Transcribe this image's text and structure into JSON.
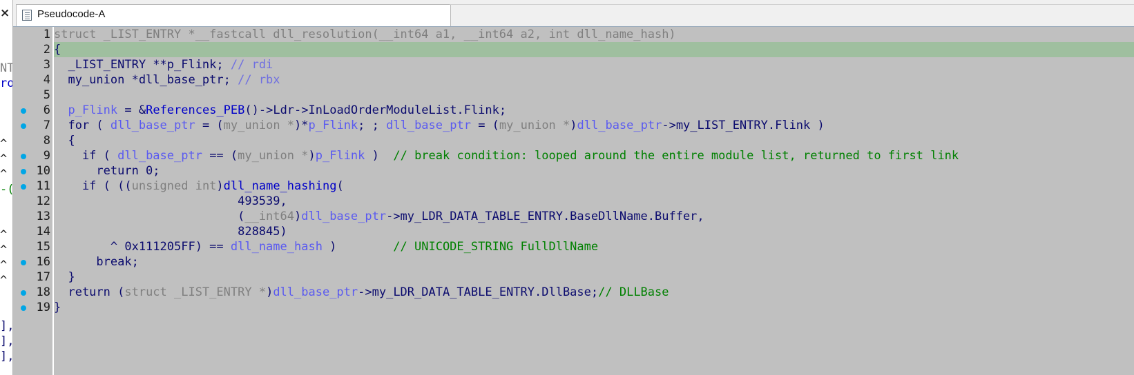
{
  "window": {
    "tab_title": "Pseudocode-A",
    "close_glyph": "×"
  },
  "left_pane": {
    "fragments": [
      {
        "row": 4,
        "text": "NT",
        "color": "#7f7f7f"
      },
      {
        "row": 5,
        "text": "ro",
        "color": "#0000c8"
      },
      {
        "row": 9,
        "text": "^",
        "color": "#222222"
      },
      {
        "row": 10,
        "text": "^",
        "color": "#222222"
      },
      {
        "row": 11,
        "text": "^",
        "color": "#222222"
      },
      {
        "row": 12,
        "text": "-(",
        "color": "#008000"
      },
      {
        "row": 15,
        "text": "^",
        "color": "#222222"
      },
      {
        "row": 16,
        "text": "^",
        "color": "#222222"
      },
      {
        "row": 17,
        "text": "^",
        "color": "#222222"
      },
      {
        "row": 18,
        "text": "^",
        "color": "#222222"
      },
      {
        "row": 21,
        "text": "],",
        "color": "#0b0b6e"
      },
      {
        "row": 22,
        "text": "],",
        "color": "#0b0b6e"
      },
      {
        "row": 23,
        "text": "],",
        "color": "#0b0b6e"
      }
    ]
  },
  "code": {
    "highlighted_line": 2,
    "lines": [
      {
        "n": "1",
        "dot": false,
        "tokens": [
          {
            "t": "struct _LIST_ENTRY *__fastcall dll_resolution(__int64 a1, __int64 a2, int dll_name_hash)",
            "c": "gray"
          }
        ]
      },
      {
        "n": "2",
        "dot": false,
        "tokens": [
          {
            "t": "{",
            "c": "dark"
          }
        ]
      },
      {
        "n": "3",
        "dot": false,
        "tokens": [
          {
            "t": "  _LIST_ENTRY **p_Flink; ",
            "c": "dark"
          },
          {
            "t": "// rdi",
            "c": "cmt2"
          }
        ]
      },
      {
        "n": "4",
        "dot": false,
        "tokens": [
          {
            "t": "  my_union *dll_base_ptr; ",
            "c": "dark"
          },
          {
            "t": "// rbx",
            "c": "cmt2"
          }
        ]
      },
      {
        "n": "5",
        "dot": false,
        "tokens": []
      },
      {
        "n": "6",
        "dot": true,
        "tokens": [
          {
            "t": "  ",
            "c": "dark"
          },
          {
            "t": "p_Flink",
            "c": "var"
          },
          {
            "t": " = &",
            "c": "dark"
          },
          {
            "t": "References_PEB",
            "c": "fn"
          },
          {
            "t": "()->Ldr->InLoadOrderModuleList.Flink;",
            "c": "dark"
          }
        ]
      },
      {
        "n": "7",
        "dot": true,
        "tokens": [
          {
            "t": "  for ( ",
            "c": "dark"
          },
          {
            "t": "dll_base_ptr",
            "c": "var"
          },
          {
            "t": " = (",
            "c": "dark"
          },
          {
            "t": "my_union *",
            "c": "gray"
          },
          {
            "t": ")*",
            "c": "dark"
          },
          {
            "t": "p_Flink",
            "c": "var"
          },
          {
            "t": "; ; ",
            "c": "dark"
          },
          {
            "t": "dll_base_ptr",
            "c": "var"
          },
          {
            "t": " = (",
            "c": "dark"
          },
          {
            "t": "my_union *",
            "c": "gray"
          },
          {
            "t": ")",
            "c": "dark"
          },
          {
            "t": "dll_base_ptr",
            "c": "var"
          },
          {
            "t": "->my_LIST_ENTRY.Flink )",
            "c": "dark"
          }
        ]
      },
      {
        "n": "8",
        "dot": false,
        "tokens": [
          {
            "t": "  {",
            "c": "dark"
          }
        ]
      },
      {
        "n": "9",
        "dot": true,
        "tokens": [
          {
            "t": "    if ( ",
            "c": "dark"
          },
          {
            "t": "dll_base_ptr",
            "c": "var"
          },
          {
            "t": " == (",
            "c": "dark"
          },
          {
            "t": "my_union *",
            "c": "gray"
          },
          {
            "t": ")",
            "c": "dark"
          },
          {
            "t": "p_Flink",
            "c": "var"
          },
          {
            "t": " )  ",
            "c": "dark"
          },
          {
            "t": "// break condition: looped around the entire module list, returned to first link",
            "c": "cmt"
          }
        ]
      },
      {
        "n": "10",
        "dot": true,
        "tokens": [
          {
            "t": "      return 0;",
            "c": "dark"
          }
        ]
      },
      {
        "n": "11",
        "dot": true,
        "tokens": [
          {
            "t": "    if ( ((",
            "c": "dark"
          },
          {
            "t": "unsigned int",
            "c": "gray"
          },
          {
            "t": ")",
            "c": "dark"
          },
          {
            "t": "dll_name_hashing",
            "c": "fn"
          },
          {
            "t": "(",
            "c": "dark"
          }
        ]
      },
      {
        "n": "12",
        "dot": false,
        "tokens": [
          {
            "t": "                          493539,",
            "c": "dark"
          }
        ]
      },
      {
        "n": "13",
        "dot": false,
        "tokens": [
          {
            "t": "                          (",
            "c": "dark"
          },
          {
            "t": "__int64",
            "c": "gray"
          },
          {
            "t": ")",
            "c": "dark"
          },
          {
            "t": "dll_base_ptr",
            "c": "var"
          },
          {
            "t": "->my_LDR_DATA_TABLE_ENTRY.BaseDllName.Buffer,",
            "c": "dark"
          }
        ]
      },
      {
        "n": "14",
        "dot": false,
        "tokens": [
          {
            "t": "                          828845)",
            "c": "dark"
          }
        ]
      },
      {
        "n": "15",
        "dot": false,
        "tokens": [
          {
            "t": "        ^ 0x111205FF) == ",
            "c": "dark"
          },
          {
            "t": "dll_name_hash",
            "c": "var"
          },
          {
            "t": " )        ",
            "c": "dark"
          },
          {
            "t": "// UNICODE_STRING FullDllName",
            "c": "cmt"
          }
        ]
      },
      {
        "n": "16",
        "dot": true,
        "tokens": [
          {
            "t": "      break;",
            "c": "dark"
          }
        ]
      },
      {
        "n": "17",
        "dot": false,
        "tokens": [
          {
            "t": "  }",
            "c": "dark"
          }
        ]
      },
      {
        "n": "18",
        "dot": true,
        "tokens": [
          {
            "t": "  return (",
            "c": "dark"
          },
          {
            "t": "struct _LIST_ENTRY *",
            "c": "gray"
          },
          {
            "t": ")",
            "c": "dark"
          },
          {
            "t": "dll_base_ptr",
            "c": "var"
          },
          {
            "t": "->my_LDR_DATA_TABLE_ENTRY.DllBase;",
            "c": "dark"
          },
          {
            "t": "// DLLBase",
            "c": "cmt"
          }
        ]
      },
      {
        "n": "19",
        "dot": true,
        "tokens": [
          {
            "t": "}",
            "c": "dark"
          }
        ]
      }
    ]
  }
}
